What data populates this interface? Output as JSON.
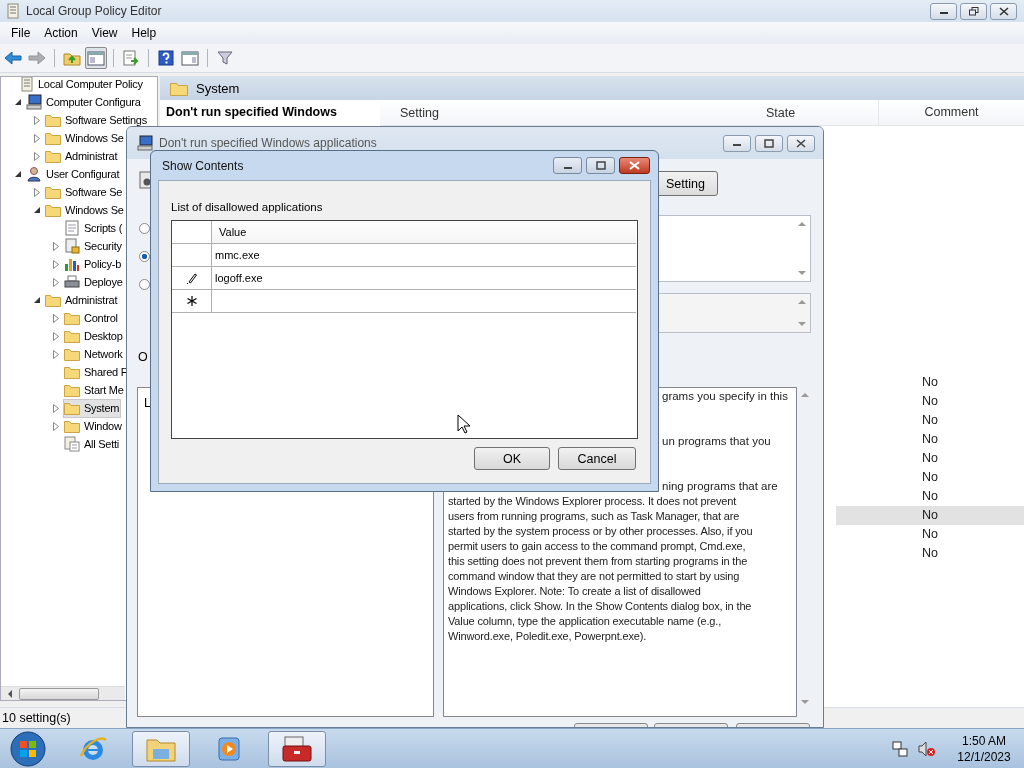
{
  "window": {
    "title": "Local Group Policy Editor"
  },
  "menu": [
    {
      "label": "File"
    },
    {
      "label": "Action"
    },
    {
      "label": "View"
    },
    {
      "label": "Help"
    }
  ],
  "toolbar": [
    [
      {
        "kind": "back",
        "pressed": false,
        "disabled": false
      },
      {
        "kind": "forward",
        "pressed": false,
        "disabled": true
      }
    ],
    [
      {
        "kind": "up",
        "pressed": false,
        "disabled": false
      },
      {
        "kind": "tree",
        "pressed": true,
        "disabled": false
      }
    ],
    [
      {
        "kind": "export",
        "pressed": false,
        "disabled": false
      }
    ],
    [
      {
        "kind": "help",
        "pressed": false,
        "disabled": false
      },
      {
        "kind": "pane",
        "pressed": false,
        "disabled": false
      }
    ],
    [
      {
        "kind": "filter",
        "pressed": false,
        "disabled": false
      }
    ]
  ],
  "tree": [
    {
      "label": "Local Computer Policy",
      "kind": "policy",
      "selected": false,
      "children": [
        {
          "label": "Computer Configura",
          "kind": "computer",
          "expanded": true,
          "selected": false,
          "children": [
            {
              "label": "Software Settings",
              "kind": "folder",
              "expanded": false,
              "selected": false
            },
            {
              "label": "Windows Se",
              "kind": "folder",
              "expanded": false,
              "selected": false
            },
            {
              "label": "Administrat",
              "kind": "folder",
              "expanded": false,
              "selected": false
            }
          ]
        },
        {
          "label": "User Configurat",
          "kind": "user",
          "expanded": true,
          "selected": false,
          "children": [
            {
              "label": "Software Se",
              "kind": "folder",
              "expanded": false,
              "selected": false
            },
            {
              "label": "Windows Se",
              "kind": "folder",
              "expanded": true,
              "selected": false,
              "children": [
                {
                  "label": "Scripts (",
                  "kind": "script",
                  "selected": false
                },
                {
                  "label": "Security",
                  "kind": "security",
                  "expanded": false,
                  "selected": false
                },
                {
                  "label": "Policy-b",
                  "kind": "chart",
                  "expanded": false,
                  "selected": false
                },
                {
                  "label": "Deploye",
                  "kind": "printer",
                  "expanded": false,
                  "selected": false
                }
              ]
            },
            {
              "label": "Administrat",
              "kind": "folder",
              "expanded": true,
              "selected": false,
              "children": [
                {
                  "label": "Control",
                  "kind": "folder",
                  "expanded": false,
                  "selected": false
                },
                {
                  "label": "Desktop",
                  "kind": "folder",
                  "expanded": false,
                  "selected": false
                },
                {
                  "label": "Network",
                  "kind": "folder",
                  "expanded": false,
                  "selected": false
                },
                {
                  "label": "Shared F",
                  "kind": "folder",
                  "selected": false
                },
                {
                  "label": "Start Me",
                  "kind": "folder",
                  "selected": false
                },
                {
                  "label": "System",
                  "kind": "folder",
                  "expanded": false,
                  "selected": true
                },
                {
                  "label": "Window",
                  "kind": "folder",
                  "expanded": false,
                  "selected": false
                },
                {
                  "label": "All Setti",
                  "kind": "settings",
                  "selected": false
                }
              ]
            }
          ]
        }
      ]
    }
  ],
  "pane": {
    "header": "System",
    "policy_title": "Don't run specified Windows",
    "columns": [
      "Setting",
      "State",
      "Comment"
    ],
    "rows": [
      {
        "comment": "No",
        "selected": false
      },
      {
        "comment": "No",
        "selected": false
      },
      {
        "comment": "No",
        "selected": false
      },
      {
        "comment": "No",
        "selected": false
      },
      {
        "comment": "No",
        "selected": false
      },
      {
        "comment": "No",
        "selected": false
      },
      {
        "comment": "No",
        "selected": false
      },
      {
        "comment": "No",
        "selected": true
      },
      {
        "comment": "No",
        "selected": false
      },
      {
        "comment": "No",
        "selected": false
      }
    ]
  },
  "status_bar": "10 setting(s)",
  "policy_window": {
    "title": "Don't run specified Windows applications",
    "next_button": "Setting",
    "radios": [
      {
        "selected": false
      },
      {
        "selected": true
      },
      {
        "selected": false
      }
    ],
    "options_label": "O",
    "options_text": "L",
    "help_fragments": [
      "grams you specify in this",
      "un programs that you",
      "ning programs that are"
    ],
    "help_lines": [
      "started by the Windows Explorer process. It does not prevent",
      "users from running programs, such as Task Manager, that are",
      "started by the system process or by other processes. Also, if you",
      "permit users to gain access to the command prompt, Cmd.exe,",
      "this setting does not prevent them from starting programs in the",
      "command window that they are not permitted to start by using",
      "Windows Explorer. Note: To create a list of disallowed",
      "applications, click Show. In the Show Contents dialog box, in the",
      "Value column, type the application executable name (e.g.,",
      "Winword.exe, Poledit.exe, Powerpnt.exe)."
    ]
  },
  "show_contents": {
    "title": "Show Contents",
    "label": "List of disallowed applications",
    "column": "Value",
    "rows": [
      {
        "kind": "row",
        "value": "mmc.exe"
      },
      {
        "kind": "editing",
        "value": "logoff.exe"
      },
      {
        "kind": "new"
      }
    ],
    "buttons": [
      "OK",
      "Cancel"
    ]
  },
  "taskbar": {
    "items": [
      {
        "kind": "browser",
        "running": false
      },
      {
        "kind": "explorer",
        "running": true
      },
      {
        "kind": "media",
        "running": false
      },
      {
        "kind": "toolbox",
        "running": true
      }
    ],
    "time": "1:50 AM",
    "date": "12/1/2023"
  }
}
